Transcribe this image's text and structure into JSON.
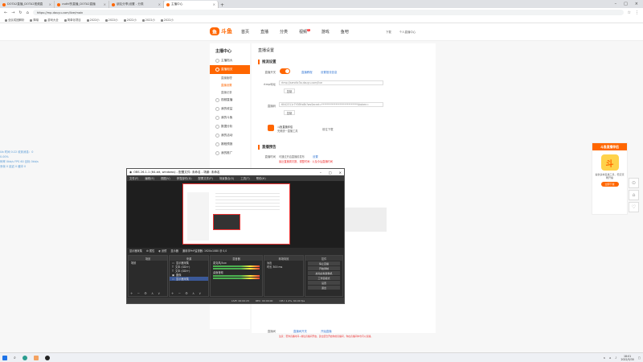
{
  "browser": {
    "tabs": [
      {
        "label": "DOTA2直播_DOTA2视频直"
      },
      {
        "label": "csdhf的直播_DOTA2直播"
      },
      {
        "label": "朋友分享|设置 - 分类"
      },
      {
        "label": "主播中心",
        "active": true
      }
    ],
    "url": "https://mp.douyu.com/live/main",
    "bookmarks": [
      "全民成团解析",
      "降噪",
      "游戏大全",
      "简单化项目",
      "2022小",
      "2022小",
      "2022小",
      "2022小",
      "2022小"
    ]
  },
  "site": {
    "logo": "斗鱼",
    "nav": [
      "首页",
      "直播",
      "分类",
      "视频",
      "游戏",
      "鱼吧"
    ],
    "nav_badge": "1",
    "nav_right": [
      "下载",
      "个人直播中心"
    ]
  },
  "sidebar": {
    "title": "主播中心",
    "items": [
      {
        "label": "主播档大"
      },
      {
        "label": "直播相关",
        "active": true
      },
      {
        "label": "直播管理",
        "sub": true
      },
      {
        "label": "直播设置",
        "sub": true,
        "on": true
      },
      {
        "label": "直播记录",
        "sub": true
      },
      {
        "label": "视频直播"
      },
      {
        "label": "我的收益"
      },
      {
        "label": "我的斗鱼"
      },
      {
        "label": "数据分析"
      },
      {
        "label": "我的活动"
      },
      {
        "label": "赛程预报"
      },
      {
        "label": "我的推广"
      }
    ]
  },
  "content": {
    "title": "直播设置",
    "section1": "推流设置",
    "live_switch_label": "直播开关",
    "link_tutorial": "直播教程",
    "link_update": "设置推流信息",
    "rtmp_label": "rtmp地址",
    "rtmp_value": "rtmp://sendtc3a.douyu.com/live",
    "copy1": "复制",
    "code_label": "直播码",
    "code_value": "6042311r7Y5BYx8k?wsSecret=****************************&token=",
    "copy2": "复制",
    "assistant_name": "斗鱼直播伴侣",
    "assistant_desc": "完美统一直播工具",
    "assistant_link": "前往下载",
    "section2": "直播预告",
    "preview_label": "直播时间",
    "preview_text": "可通过开启直播前发布",
    "preview_link": "设置",
    "warn_text": "最近直播周次数，调整时间：以及今后直播时间",
    "bottom_label": "直播间",
    "bottom_link1": "直播间开关",
    "bottom_link2": "开始直播",
    "bottom_warn": "注意：若你直播时间~前往直播间开启，建立结合开启你的直播间，你在直播间中也可以直播。"
  },
  "promo": {
    "head": "斗鱼直播伴侣",
    "glyph": "斗",
    "text": "提供多种直播工具，稳定流畅开播",
    "button": "立即下载"
  },
  "float_buttons": [
    "⊙",
    "⌂",
    "♡"
  ],
  "left_stats": [
    "Ub      时间  0:22  收到消息：0",
    "0.00%",
    "码率  0kb/s   FPS  60   目标  0kb/s",
    "丢帧  0      延迟  0      缓冲  0"
  ],
  "obs": {
    "title": "OBS 26.1.1 (64-bit, windows) - 配置文件: 未命名 - 场景: 未命名",
    "menu": [
      "文件(F)",
      "编辑(E)",
      "视图(V)",
      "停靠部件(D)",
      "配置文件(P)",
      "场景集合(S)",
      "工具(T)",
      "帮助(H)"
    ],
    "source_bar": [
      "显示器采集",
      "属性",
      "滤镜",
      "显示器",
      "通用非PnP监视器: 1920x1080 @ 0,0"
    ],
    "docks": {
      "scenes": {
        "head": "场景",
        "rows": [
          "场景"
        ]
      },
      "sources": {
        "head": "来源",
        "rows": [
          "显示器采集",
          "文本 (GDI+)",
          "文本 (GDI+)",
          "图像",
          "显示器采集"
        ]
      },
      "mixer": {
        "head": "混音器",
        "rows": [
          "麦克风/Aux",
          "桌面音频"
        ]
      },
      "transitions": {
        "head": "转场特效",
        "rows": [
          "淡出",
          "时长 300 ms"
        ]
      },
      "controls": {
        "head": "控件",
        "buttons": [
          "停止直播",
          "开始录制",
          "启动虚拟摄像机",
          "工作室模式",
          "设置",
          "退出"
        ]
      }
    },
    "status": [
      "LIVE: 00:00:23",
      "REC: 00:00:00",
      "CPU: 1.4%, 60.00 fps"
    ],
    "footer_icons": "+ − ⚙ ∧ ∨"
  },
  "taskbar": {
    "clock_time": "18:01",
    "clock_date": "2022/5/30"
  }
}
